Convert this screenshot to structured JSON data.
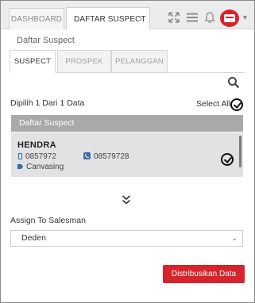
{
  "top_tabs": [
    {
      "label": "DASHBOARD"
    },
    {
      "label": "DAFTAR SUSPECT",
      "close": "×"
    }
  ],
  "header_icons": [
    "expand-icon",
    "menu-icon",
    "bell-icon",
    "avatar",
    "chevron-down-icon"
  ],
  "page_title": "Daftar Suspect",
  "sub_tabs": [
    {
      "label": "SUSPECT",
      "active": true
    },
    {
      "label": "PROSPEK",
      "active": false
    },
    {
      "label": "PELANGGAN",
      "active": false
    }
  ],
  "selection": {
    "info": "Dipilih 1 Dari 1 Data",
    "select_all": "Select All"
  },
  "list": {
    "header": "Daftar Suspect",
    "items": [
      {
        "name": "HENDRA",
        "mobile": "0857972",
        "phone": "08579728",
        "tag": "Canvasing",
        "selected": true
      }
    ]
  },
  "assign": {
    "label": "Assign To Salesman",
    "selected": "Deden"
  },
  "primary_button": "Distribusikan Data",
  "colors": {
    "accent": "#d6242c",
    "header_gray": "#a9a9a9",
    "card_gray": "#e2e2e2",
    "icon_blue": "#2a6fb5"
  }
}
